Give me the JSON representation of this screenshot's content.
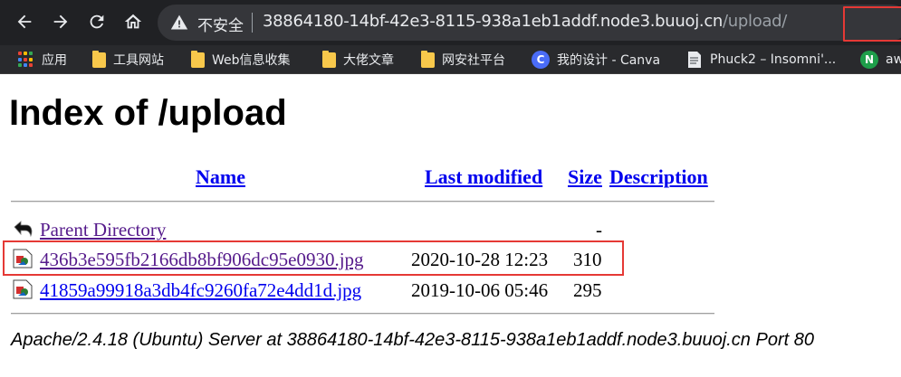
{
  "browser": {
    "security_label": "不安全",
    "url_host": "38864180-14bf-42e3-8115-938a1eb1addf.node3.buuoj.cn",
    "url_path": "/upload/",
    "bookmarks": [
      {
        "label": "应用",
        "icon": "apps-icon"
      },
      {
        "label": "工具网站",
        "icon": "folder-icon"
      },
      {
        "label": "Web信息收集",
        "icon": "folder-icon"
      },
      {
        "label": "大佬文章",
        "icon": "folder-icon"
      },
      {
        "label": "网安社平台",
        "icon": "folder-icon"
      },
      {
        "label": "我的设计 - Canva",
        "icon": "canva-icon"
      },
      {
        "label": "Phuck2 – Insomni'...",
        "icon": "page-icon"
      },
      {
        "label": "aw",
        "icon": "n-icon"
      }
    ]
  },
  "page": {
    "title": "Index of /upload",
    "headers": {
      "name": "Name",
      "last_modified": "Last modified",
      "size": "Size",
      "description": "Description"
    },
    "parent": {
      "label": "Parent Directory",
      "size": "-"
    },
    "files": [
      {
        "name": "436b3e595fb2166db8bf906dc95e0930.jpg",
        "modified": "2020-10-28 12:23",
        "size": "310"
      },
      {
        "name": "41859a99918a3db4fc9260fa72e4dd1d.jpg",
        "modified": "2019-10-06 05:46",
        "size": "295"
      }
    ],
    "address": "Apache/2.4.18 (Ubuntu) Server at 38864180-14bf-42e3-8115-938a1eb1addf.node3.buuoj.cn Port 80"
  },
  "colors": {
    "highlight": "#e53935",
    "link": "#0000ee",
    "visited": "#551a8b",
    "chrome_bg": "#202124"
  }
}
